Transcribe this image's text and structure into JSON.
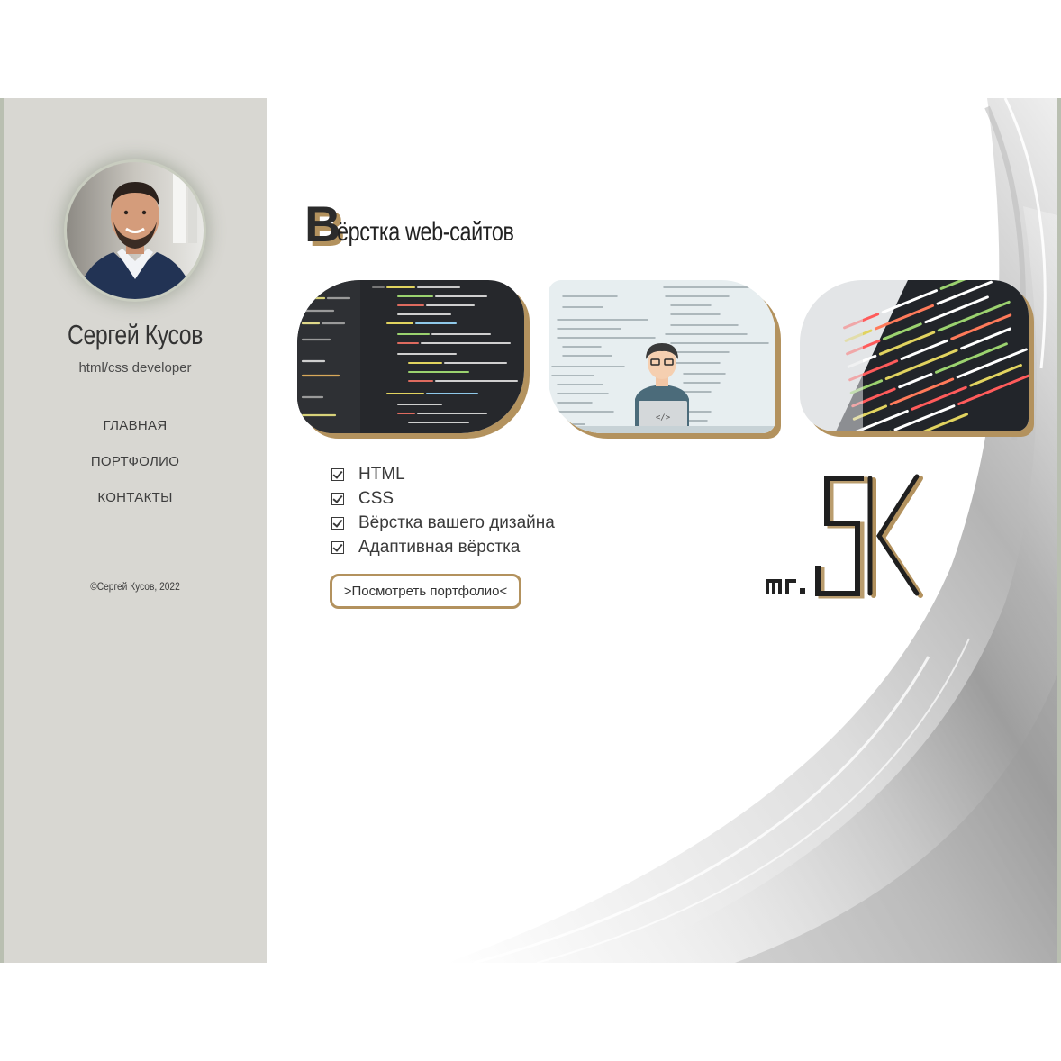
{
  "profile": {
    "name": "Сергей Кусов",
    "role": "html/css developer"
  },
  "nav": {
    "items": [
      {
        "label": "ГЛАВНАЯ"
      },
      {
        "label": "ПОРТФОЛИО"
      },
      {
        "label": "КОНТАКТЫ"
      }
    ]
  },
  "footer": {
    "copyright": "©Сергей Кусов, 2022"
  },
  "main": {
    "title_initial": "В",
    "title_rest": "ёрстка web-сайтов",
    "features": [
      {
        "label": "HTML"
      },
      {
        "label": "CSS"
      },
      {
        "label": "Вёрстка вашего дизайна"
      },
      {
        "label": "Адаптивная вёрстка"
      }
    ],
    "portfolio_button": ">Посмотреть портфолио<",
    "logo_text": "mr."
  },
  "colors": {
    "sidebar_bg": "#d8d7d2",
    "accent_gold": "#b3925e",
    "text_dark": "#333333",
    "frame_border": "#b9bfb1"
  }
}
